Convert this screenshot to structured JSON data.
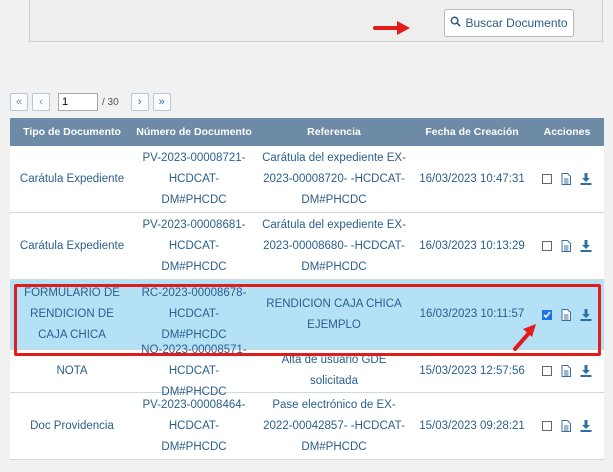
{
  "search": {
    "button_label": "Buscar Documento",
    "icon": "search-icon"
  },
  "pager": {
    "current_page": "1",
    "total": "/ 30"
  },
  "table": {
    "headers": [
      "Tipo de Documento",
      "Número de Documento",
      "Referencia",
      "Fecha de Creación",
      "Acciones"
    ],
    "rows": [
      {
        "tipo": "Carátula Expediente",
        "numero": "PV-2023-00008721- HCDCAT-DM#PHCDC",
        "referencia": "Carátula del expediente EX-2023-00008720- -HCDCAT-DM#PHCDC",
        "fecha": "16/03/2023 10:47:31",
        "checked": false
      },
      {
        "tipo": "Carátula Expediente",
        "numero": "PV-2023-00008681- HCDCAT-DM#PHCDC",
        "referencia": "Carátula del expediente EX-2023-00008680- -HCDCAT-DM#PHCDC",
        "fecha": "16/03/2023 10:13:29",
        "checked": false
      },
      {
        "tipo": "FORMULARIO DE RENDICION DE CAJA CHICA",
        "numero": "RC-2023-00008678- HCDCAT-DM#PHCDC",
        "referencia": "RENDICION CAJA CHICA EJEMPLO",
        "fecha": "16/03/2023 10:11:57",
        "checked": true,
        "selected": true
      },
      {
        "tipo": "NOTA",
        "numero": "NO-2023-00008571- HCDCAT-DM#PHCDC",
        "referencia": "Alta de usuario GDE solicitada",
        "fecha": "15/03/2023 12:57:56",
        "checked": false
      },
      {
        "tipo": "Doc Providencia",
        "numero": "PV-2023-00008464- HCDCAT-DM#PHCDC",
        "referencia": "Pase electrónico de EX-2022-00042857- -HCDCAT-DM#PHCDC",
        "fecha": "15/03/2023 09:28:21",
        "checked": false
      }
    ]
  },
  "colors": {
    "header_bg": "#6d8aa6",
    "selected_row_bg": "#b5e1f6",
    "highlight_red": "#e21b1b",
    "text_blue": "#2a5f8c"
  }
}
